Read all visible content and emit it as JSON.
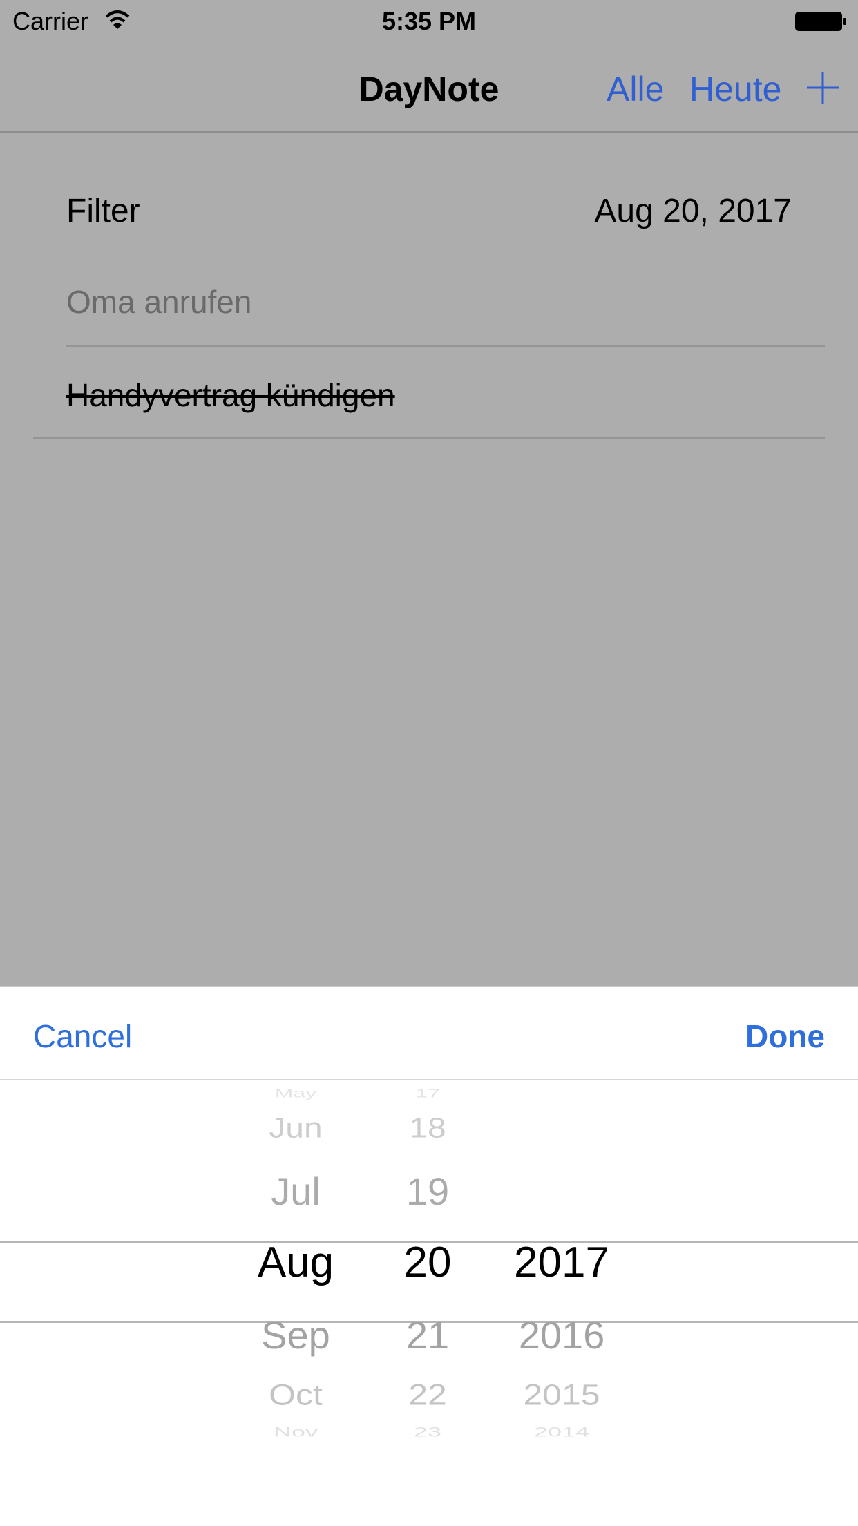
{
  "status_bar": {
    "carrier": "Carrier",
    "time": "5:35 PM"
  },
  "nav": {
    "title": "DayNote",
    "alle_label": "Alle",
    "heute_label": "Heute",
    "add_icon": "plus-icon"
  },
  "filter": {
    "label": "Filter",
    "date": "Aug 20, 2017"
  },
  "todos": [
    {
      "text": "Oma anrufen",
      "done": false
    },
    {
      "text": "Handyvertrag kündigen",
      "done": true
    }
  ],
  "picker": {
    "cancel_label": "Cancel",
    "done_label": "Done",
    "months": [
      "May",
      "Jun",
      "Jul",
      "Aug",
      "Sep",
      "Oct",
      "Nov"
    ],
    "days": [
      "17",
      "18",
      "19",
      "20",
      "21",
      "22",
      "23"
    ],
    "years_below": [
      "2016",
      "2015",
      "2014"
    ],
    "selected": {
      "month": "Aug",
      "day": "20",
      "year": "2017"
    }
  },
  "colors": {
    "accent": "#2f6fdc",
    "dim_background": "#adadad"
  }
}
